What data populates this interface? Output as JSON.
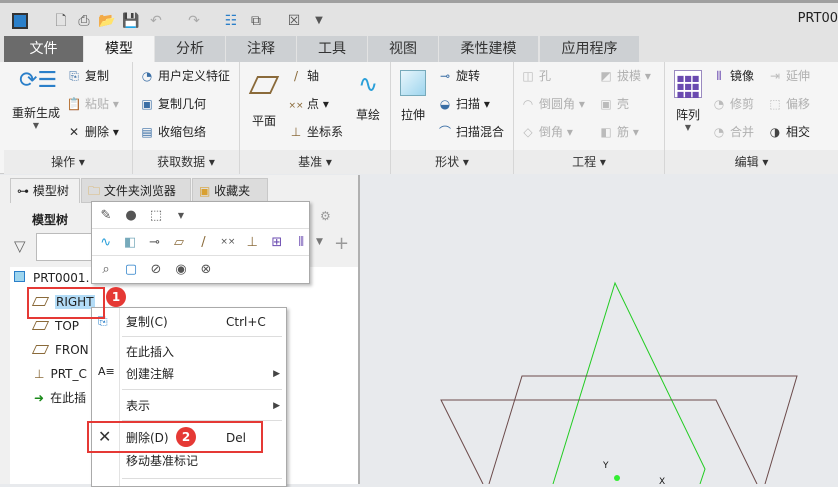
{
  "window": {
    "title": "PRT00"
  },
  "quick_access": [
    "app-icon",
    "new-icon",
    "print-icon",
    "open-icon",
    "save-icon",
    "undo-icon",
    "redo-icon",
    "regenerate-icon",
    "windows-icon",
    "close-icon",
    "customize-icon"
  ],
  "tabs": [
    "文件",
    "模型",
    "分析",
    "注释",
    "工具",
    "视图",
    "柔性建模",
    "应用程序"
  ],
  "ribbon": {
    "ops": {
      "label": "操作",
      "regen": "重新生成",
      "copy": "复制",
      "paste": "粘贴",
      "delete": "删除"
    },
    "getdata": {
      "label": "获取数据",
      "udf": "用户定义特征",
      "copygeom": "复制几何",
      "shrinkwrap": "收缩包络"
    },
    "datum": {
      "label": "基准",
      "plane": "平面",
      "axis": "轴",
      "point": "点",
      "csys": "坐标系",
      "sketch": "草绘"
    },
    "shapes": {
      "label": "形状",
      "extrude": "拉伸",
      "revolve": "旋转",
      "sweep": "扫描",
      "swept_blend": "扫描混合"
    },
    "engineering": {
      "label": "工程",
      "hole": "孔",
      "round": "倒圆角",
      "chamfer": "倒角",
      "draft": "拔模",
      "shell": "壳",
      "rib": "筋"
    },
    "editing": {
      "label": "编辑",
      "pattern": "阵列",
      "mirror": "镜像",
      "extend": "延伸",
      "trim": "修剪",
      "offset": "偏移",
      "merge": "合并",
      "intersect": "相交"
    }
  },
  "panel": {
    "tabs": [
      "模型树",
      "文件夹浏览器",
      "收藏夹"
    ],
    "header": "模型树",
    "filter_value": "",
    "tree": [
      {
        "label": "PRT0001."
      },
      {
        "label": "RIGHT"
      },
      {
        "label": "TOP"
      },
      {
        "label": "FRON"
      },
      {
        "label": "PRT_C"
      },
      {
        "label": "在此插"
      }
    ]
  },
  "context_menu": {
    "items": [
      {
        "label": "复制(C)",
        "shortcut": "Ctrl+C"
      },
      {
        "label": "在此插入"
      },
      {
        "label": "创建注解"
      },
      {
        "label": "表示"
      },
      {
        "label": "删除(D)",
        "shortcut": "Del"
      },
      {
        "label": "移动基准标记"
      }
    ]
  },
  "annotations": {
    "badge1": "1",
    "badge2": "2"
  },
  "graphics": {
    "axis_y": "Y",
    "axis_x": "X"
  },
  "colors": {
    "accent_red": "#e53935",
    "selection": "#b3dcf7",
    "datum_plane": "#6b4a4a",
    "sketch_green": "#22cc22"
  }
}
